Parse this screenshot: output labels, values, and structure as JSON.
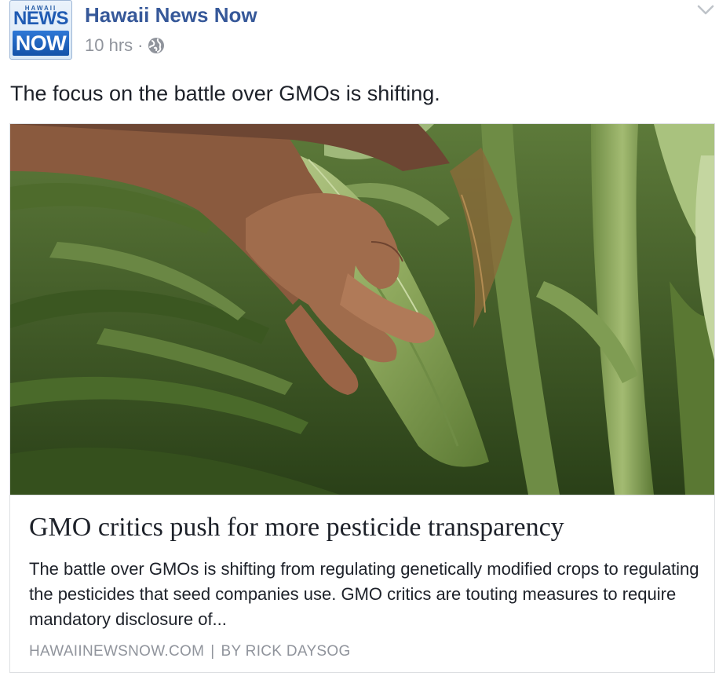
{
  "post": {
    "page_name": "Hawaii News Now",
    "avatar": {
      "small": "HAWAII",
      "line1": "NEWS",
      "line2": "NOW"
    },
    "time": "10 hrs",
    "separator": "·",
    "privacy_icon": "globe-icon",
    "menu_icon": "chevron-down-icon",
    "message": "The focus on the battle over GMOs is shifting."
  },
  "link_card": {
    "headline": "GMO critics push for more pesticide transparency",
    "description": "The battle over GMOs is shifting from regulating genetically modified crops to regulating the pesticides that seed companies use. GMO critics are touting measures to require mandatory disclosure of...",
    "domain": "HAWAIINEWSNOW.COM",
    "divider": "|",
    "byline": "BY RICK DAYSOG"
  },
  "colors": {
    "page_name": "#365899",
    "meta": "#90949c",
    "text": "#1d2129",
    "border": "#dddfe2"
  }
}
